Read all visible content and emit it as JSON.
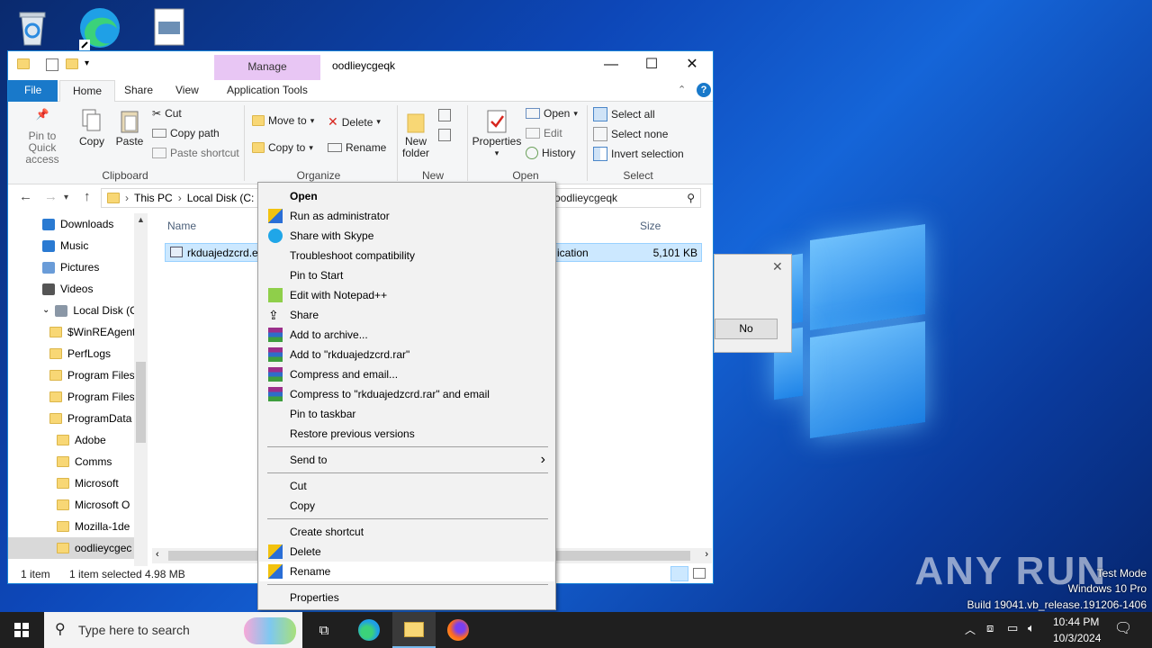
{
  "window": {
    "title": "oodlieycgeqk",
    "manage_tab": "Manage",
    "controls": {
      "minimize": "—",
      "maximize": "☐",
      "close": "✕"
    }
  },
  "ribbon_tabs": [
    "File",
    "Home",
    "Share",
    "View",
    "Application Tools"
  ],
  "ribbon": {
    "clipboard": {
      "pin_label": "Pin to Quick",
      "pin_label2": "access",
      "copy": "Copy",
      "paste": "Paste",
      "cut": "Cut",
      "copy_path": "Copy path",
      "paste_shortcut": "Paste shortcut",
      "group": "Clipboard"
    },
    "organize": {
      "move_to": "Move to",
      "copy_to": "Copy to",
      "delete": "Delete",
      "rename": "Rename",
      "group": "Organize"
    },
    "new": {
      "new_folder1": "New",
      "new_folder2": "folder",
      "group": "New"
    },
    "open": {
      "properties": "Properties",
      "open": "Open",
      "edit": "Edit",
      "history": "History",
      "group": "Open"
    },
    "select": {
      "select_all": "Select all",
      "select_none": "Select none",
      "invert": "Invert selection",
      "group": "Select"
    }
  },
  "address": {
    "this_pc": "This PC",
    "local_disk": "Local Disk (C:",
    "search_text": "n oodlieycgeqk"
  },
  "columns": {
    "name": "Name",
    "size": "Size"
  },
  "file_row": {
    "name": "rkduajedzcrd.ex",
    "type": "ication",
    "size": "5,101 KB"
  },
  "sidebar": [
    {
      "label": "Downloads",
      "icon": "download-icon"
    },
    {
      "label": "Music",
      "icon": "music-icon"
    },
    {
      "label": "Pictures",
      "icon": "pictures-icon"
    },
    {
      "label": "Videos",
      "icon": "videos-icon"
    },
    {
      "label": "Local Disk (C:)",
      "icon": "drive-icon"
    },
    {
      "label": "$WinREAgent",
      "icon": "folder-icon"
    },
    {
      "label": "PerfLogs",
      "icon": "folder-icon"
    },
    {
      "label": "Program Files",
      "icon": "folder-icon"
    },
    {
      "label": "Program Files",
      "icon": "folder-icon"
    },
    {
      "label": "ProgramData",
      "icon": "folder-icon"
    },
    {
      "label": "Adobe",
      "icon": "folder-icon"
    },
    {
      "label": "Comms",
      "icon": "folder-icon"
    },
    {
      "label": "Microsoft",
      "icon": "folder-icon"
    },
    {
      "label": "Microsoft O",
      "icon": "folder-icon"
    },
    {
      "label": "Mozilla-1de",
      "icon": "folder-icon"
    },
    {
      "label": "oodlieycgec",
      "icon": "folder-icon"
    }
  ],
  "status": {
    "count": "1 item",
    "selected": "1 item selected  4.98 MB"
  },
  "dialog": {
    "no_label": "No",
    "close": "✕"
  },
  "context_menu": [
    {
      "label": "Open",
      "bold": true
    },
    {
      "label": "Run as administrator",
      "icon": "uac-shield-icon"
    },
    {
      "label": "Share with Skype",
      "icon": "skype-icon"
    },
    {
      "label": "Troubleshoot compatibility"
    },
    {
      "label": "Pin to Start"
    },
    {
      "label": "Edit with Notepad++",
      "icon": "notepadpp-icon"
    },
    {
      "label": "Share",
      "icon": "share-icon"
    },
    {
      "label": "Add to archive...",
      "icon": "winrar-icon"
    },
    {
      "label": "Add to \"rkduajedzcrd.rar\"",
      "icon": "winrar-icon"
    },
    {
      "label": "Compress and email...",
      "icon": "winrar-icon"
    },
    {
      "label": "Compress to \"rkduajedzcrd.rar\" and email",
      "icon": "winrar-icon"
    },
    {
      "label": "Pin to taskbar"
    },
    {
      "label": "Restore previous versions"
    },
    {
      "label": "Send to",
      "submenu": true
    },
    {
      "label": "Cut"
    },
    {
      "label": "Copy"
    },
    {
      "label": "Create shortcut"
    },
    {
      "label": "Delete",
      "icon": "uac-shield-icon"
    },
    {
      "label": "Rename",
      "icon": "uac-shield-icon",
      "highlighted": true
    },
    {
      "label": "Properties"
    }
  ],
  "taskbar": {
    "search_placeholder": "Type here to search"
  },
  "tray": {
    "time": "10:44 PM",
    "date": "10/3/2024"
  },
  "watermark": {
    "brand": "ANY RUN",
    "line1": "Test Mode",
    "line2": "Windows 10 Pro",
    "line3": "Build 19041.vb_release.191206-1406"
  },
  "colors": {
    "accent": "#1979ca",
    "manage_tab": "#e8c6f4",
    "selection": "#cce8ff"
  }
}
